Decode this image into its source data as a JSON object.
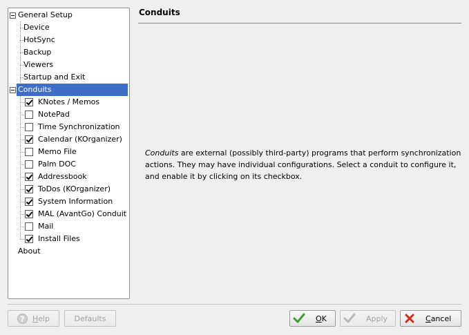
{
  "tree": {
    "general_setup": {
      "label": "General Setup",
      "children": [
        "Device",
        "HotSync",
        "Backup",
        "Viewers",
        "Startup and Exit"
      ]
    },
    "conduits": {
      "label": "Conduits",
      "items": [
        {
          "label": "KNotes / Memos",
          "checked": true
        },
        {
          "label": "NotePad",
          "checked": false
        },
        {
          "label": "Time Synchronization",
          "checked": false
        },
        {
          "label": "Calendar (KOrganizer)",
          "checked": true
        },
        {
          "label": "Memo File",
          "checked": false
        },
        {
          "label": "Palm DOC",
          "checked": false
        },
        {
          "label": "Addressbook",
          "checked": true
        },
        {
          "label": "ToDos (KOrganizer)",
          "checked": true
        },
        {
          "label": "System Information",
          "checked": true
        },
        {
          "label": "MAL (AvantGo) Conduit",
          "checked": true
        },
        {
          "label": "Mail",
          "checked": false
        },
        {
          "label": "Install Files",
          "checked": true
        }
      ]
    },
    "about": {
      "label": "About"
    }
  },
  "panel": {
    "title": "Conduits",
    "desc_em": "Conduits",
    "desc_rest": " are external (possibly third-party) programs that perform synchronization actions. They may have individual configurations. Select a conduit to configure it, and enable it by clicking on its checkbox."
  },
  "buttons": {
    "help": {
      "text": "Help",
      "mnemonic": "H",
      "rest": "elp"
    },
    "defaults": {
      "text": "Defaults"
    },
    "ok": {
      "text": "OK",
      "mnemonic": "O",
      "rest": "K"
    },
    "apply": {
      "text": "Apply"
    },
    "cancel": {
      "text": "Cancel",
      "mnemonic": "C",
      "rest": "ancel"
    }
  },
  "colors": {
    "selection": "#3f6ec9",
    "ok_check": "#3aa02a",
    "cancel_x": "#d42a1a"
  },
  "selected_item": "Conduits"
}
